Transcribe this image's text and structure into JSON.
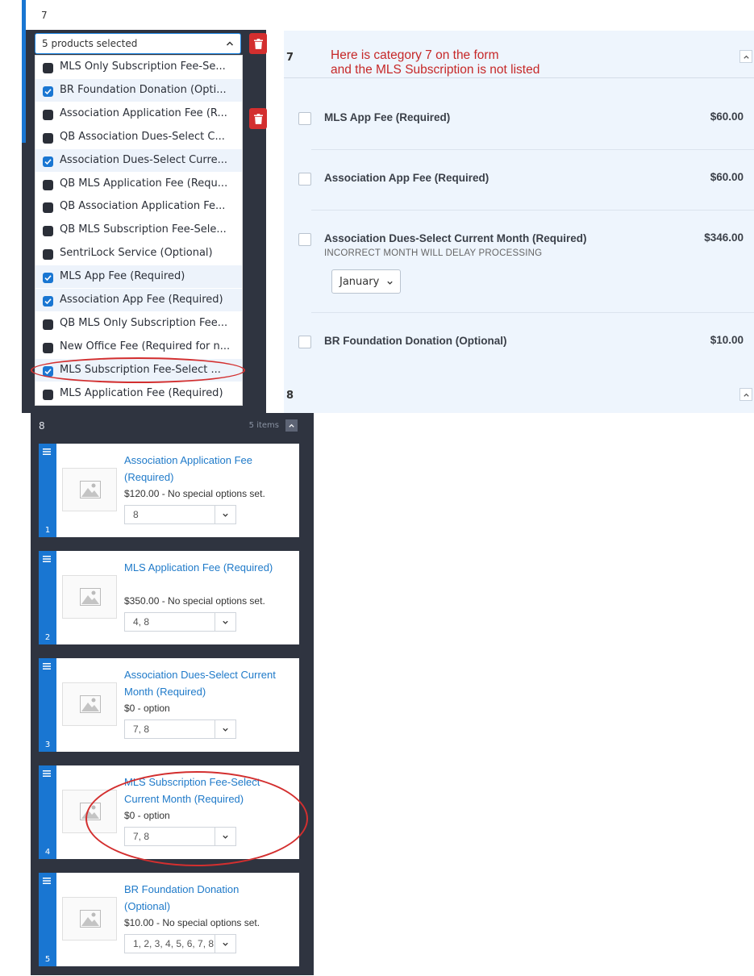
{
  "category_panel": {
    "number": "7",
    "multiselect_label": "5 products selected",
    "options": [
      {
        "label": "MLS Only Subscription Fee-Se...",
        "checked": false
      },
      {
        "label": "BR Foundation Donation (Opti...",
        "checked": true
      },
      {
        "label": "Association Application Fee (R...",
        "checked": false
      },
      {
        "label": "QB Association Dues-Select C...",
        "checked": false
      },
      {
        "label": "Association Dues-Select Curre...",
        "checked": true
      },
      {
        "label": "QB MLS Application Fee (Requ...",
        "checked": false
      },
      {
        "label": "QB Association Application Fe...",
        "checked": false
      },
      {
        "label": "QB MLS Subscription Fee-Sele...",
        "checked": false
      },
      {
        "label": "SentriLock Service (Optional)",
        "checked": false
      },
      {
        "label": "MLS App Fee (Required)",
        "checked": true
      },
      {
        "label": "Association App Fee (Required)",
        "checked": true
      },
      {
        "label": "QB MLS Only Subscription Fee...",
        "checked": false
      },
      {
        "label": "New Office Fee (Required for n...",
        "checked": false
      },
      {
        "label": "MLS Subscription Fee-Select ...",
        "checked": true
      },
      {
        "label": "MLS Application Fee (Required)",
        "checked": false
      }
    ]
  },
  "form_preview": {
    "section_number": "7",
    "next_section_number": "8",
    "note_line1": "Here is category 7 on the form",
    "note_line2": "and the MLS Subscription is not listed",
    "products": [
      {
        "name": "MLS App Fee (Required)",
        "price": "$60.00"
      },
      {
        "name": "Association App Fee (Required)",
        "price": "$60.00"
      },
      {
        "name": "Association Dues-Select Current Month (Required)",
        "price": "$346.00",
        "subtext": "INCORRECT MONTH WILL DELAY PROCESSING",
        "selected_month": "January"
      },
      {
        "name": "BR Foundation Donation (Optional)",
        "price": "$10.00"
      }
    ]
  },
  "items_panel": {
    "category_number": "8",
    "count_label": "5 items",
    "items": [
      {
        "index": "1",
        "title": "Association Application Fee (Required)",
        "price": "$120.00 - No special options set.",
        "categories": "8"
      },
      {
        "index": "2",
        "title": "MLS Application Fee (Required)",
        "price": "$350.00 - No special options set.",
        "categories": "4, 8"
      },
      {
        "index": "3",
        "title": "Association Dues-Select Current Month (Required)",
        "price": "$0 - option",
        "categories": "7, 8"
      },
      {
        "index": "4",
        "title": "MLS Subscription Fee-Select Current Month (Required)",
        "price": "$0 - option",
        "categories": "7, 8"
      },
      {
        "index": "5",
        "title": "BR Foundation Donation (Optional)",
        "price": "$10.00 - No special options set.",
        "categories": "1, 2, 3, 4, 5, 6, 7, 8"
      }
    ]
  },
  "colors": {
    "accent": "#1976d2",
    "danger": "#d32f2f",
    "panel_dark": "#2f3440",
    "annotation": "#d32f2f"
  }
}
